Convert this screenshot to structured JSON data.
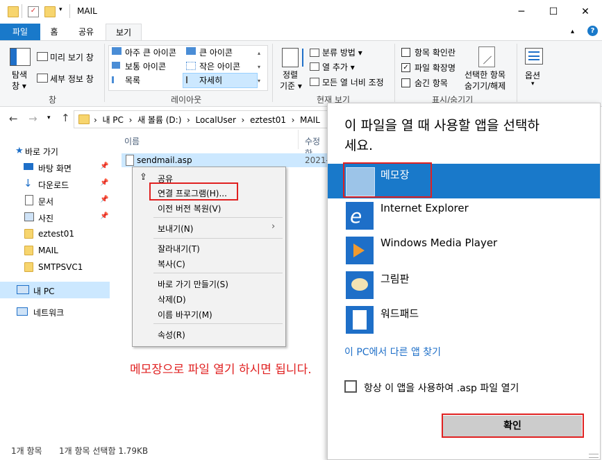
{
  "window": {
    "title": "MAIL",
    "min": "─",
    "max": "☐",
    "close": "✕"
  },
  "tabs": [
    "파일",
    "홈",
    "공유",
    "보기"
  ],
  "ribbon": {
    "nav_pane": "탐색\n창",
    "nav_pane_line1": "탐색",
    "nav_pane_line2": "창",
    "preview": "미리 보기 창",
    "details_pane": "세부 정보 창",
    "pane_group": "창",
    "layout_items": [
      "아주 큰 아이콘",
      "큰 아이콘",
      "보통 아이콘",
      "작은 아이콘",
      "목록",
      "자세히"
    ],
    "layout_group": "레이아웃",
    "sort_line1": "정렬",
    "sort_line2": "기준",
    "group_by": "분류 방법",
    "add_columns": "열 추가",
    "fit_columns": "모든 열 너비 조정",
    "current_view_group": "현재 보기",
    "item_checkboxes": "항목 확인란",
    "file_extensions": "파일 확장명",
    "hidden_items": "숨긴 항목",
    "hide_selected_line1": "선택한 항목",
    "hide_selected_line2": "숨기기/해제",
    "show_hide_group": "표시/숨기기",
    "options": "옵션"
  },
  "address": {
    "segments": [
      "내 PC",
      "새 볼륨 (D:)",
      "LocalUser",
      "eztest01",
      "MAIL"
    ]
  },
  "nav_pane": {
    "quick_access": "바로 가기",
    "items": [
      "바탕 화면",
      "다운로드",
      "문서",
      "사진",
      "eztest01",
      "MAIL",
      "SMTPSVC1"
    ],
    "this_pc": "내 PC",
    "network": "네트워크"
  },
  "file_list": {
    "col_name": "이름",
    "col_modified": "수정한",
    "file_name": "sendmail.asp",
    "file_date": "2021-"
  },
  "context_menu": {
    "share": "공유",
    "open_with": "연결 프로그램(H)...",
    "restore": "이전 버전 복원(V)",
    "send_to": "보내기(N)",
    "cut": "잘라내기(T)",
    "copy": "복사(C)",
    "shortcut": "바로 가기 만들기(S)",
    "delete": "삭제(D)",
    "rename": "이름 바꾸기(M)",
    "properties": "속성(R)"
  },
  "annotation": "메모장으로 파일 열기 하시면 됩니다.",
  "status": {
    "count": "1개 항목",
    "selected": "1개 항목 선택함 1.79KB"
  },
  "dialog": {
    "title_line1": "이 파일을 열 때 사용할 앱을 선택하",
    "title_line2": "세요.",
    "apps": [
      "메모장",
      "Internet Explorer",
      "Windows Media Player",
      "그림판",
      "워드패드"
    ],
    "more_apps_link": "이 PC에서 다른 앱 찾기",
    "always_use": "항상 이 앱을 사용하여 .asp 파일 열기",
    "ok": "확인"
  },
  "colors": {
    "accent": "#1979ca",
    "selection": "#cce8ff",
    "highlight": "#e02020",
    "link": "#1e6fc8"
  }
}
